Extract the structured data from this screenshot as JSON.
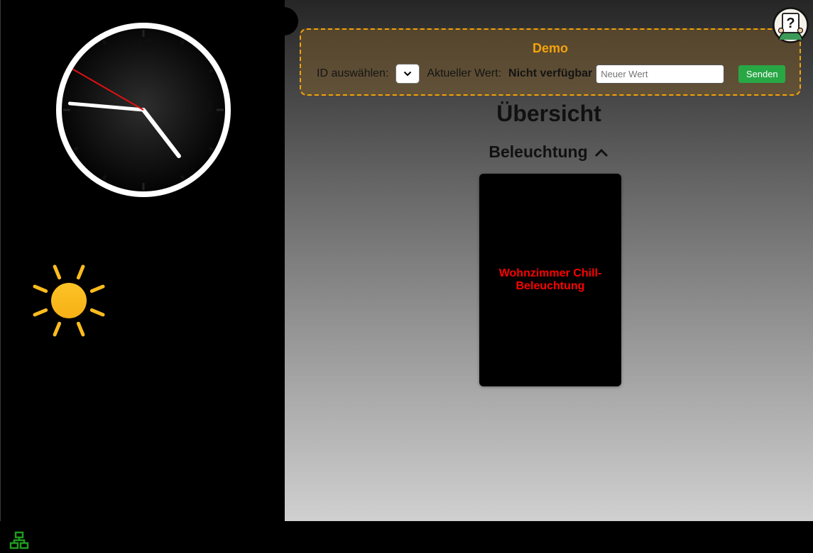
{
  "demo": {
    "title": "Demo",
    "id_label": "ID auswählen:",
    "id_selected": "",
    "current_value_label": "Aktueller Wert:",
    "current_value": "Nicht verfügbar",
    "new_value_placeholder": "Neuer Wert",
    "send_label": "Senden"
  },
  "page": {
    "title": "Übersicht"
  },
  "section": {
    "title": "Beleuchtung",
    "icon": "chevron-up-icon"
  },
  "cards": [
    {
      "label": "Wohnzimmer Chill-Beleuchtung"
    }
  ],
  "clock": {
    "hours": "4",
    "minutes": "45",
    "seconds": "50",
    "numerals": [
      "12",
      "3",
      "6",
      "9"
    ]
  },
  "weather": {
    "icon": "sun-icon"
  },
  "status": {
    "icon": "network-icon"
  },
  "colors": {
    "accent_orange": "#f5a30c",
    "send_green": "#28a745",
    "card_text_red": "#ff0000",
    "network_green": "#1f9a1f",
    "sun_yellow": "#fbbc1f",
    "clock_second_hand": "#e01010"
  }
}
